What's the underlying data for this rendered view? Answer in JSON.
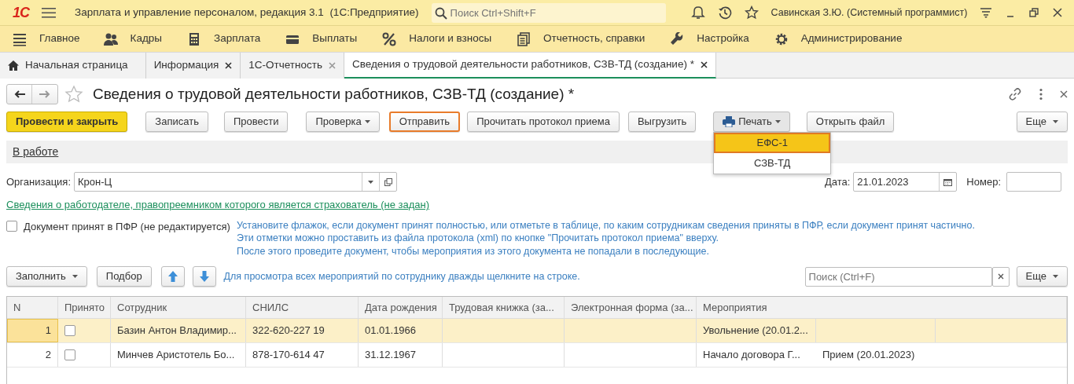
{
  "app_bar": {
    "logo": "1С",
    "title": "Зарплата и управление персоналом, редакция 3.1  (1С:Предприятие)",
    "search_placeholder": "Поиск Ctrl+Shift+F",
    "user": "Савинская З.Ю. (Системный программист)"
  },
  "sections": [
    {
      "label": "Главное"
    },
    {
      "label": "Кадры"
    },
    {
      "label": "Зарплата"
    },
    {
      "label": "Выплаты"
    },
    {
      "label": "Налоги и взносы"
    },
    {
      "label": "Отчетность, справки"
    },
    {
      "label": "Настройка"
    },
    {
      "label": "Администрирование"
    }
  ],
  "tabs": [
    {
      "label": "Начальная страница",
      "selected": false
    },
    {
      "label": "Информация",
      "selected": false
    },
    {
      "label": "1С-Отчетность",
      "selected": false
    },
    {
      "label": "Сведения о трудовой деятельности работников, СЗВ-ТД (создание) *",
      "selected": true
    }
  ],
  "document": {
    "title": "Сведения о трудовой деятельности работников, СЗВ-ТД (создание) *",
    "toolbar": [
      {
        "label": "Провести и закрыть",
        "kind": "primary"
      },
      {
        "label": "Записать",
        "kind": "plain"
      },
      {
        "label": "Провести",
        "kind": "plain"
      },
      {
        "label": "Проверка",
        "kind": "dropdown"
      },
      {
        "label": "Отправить",
        "kind": "focused"
      },
      {
        "label": "Прочитать протокол приема",
        "kind": "plain"
      },
      {
        "label": "Выгрузить",
        "kind": "plain"
      },
      {
        "label": "Печать",
        "kind": "print"
      },
      {
        "label": "Открыть файл",
        "kind": "plain"
      }
    ],
    "more": "Еще",
    "print_menu": [
      {
        "label": "ЕФС-1",
        "selected": true
      },
      {
        "label": "СЗВ-ТД",
        "selected": false
      }
    ],
    "status": "В работе",
    "organization": {
      "label": "Организация:",
      "value": "Крон-Ц"
    },
    "date": {
      "label": "Дата:",
      "value": "21.01.2023"
    },
    "number": {
      "label": "Номер:"
    },
    "employer_link": "Сведения о работодателе, правопреемником которого является страхователь (не задан)",
    "accepted": {
      "label": "Документ принят в ПФР (не редактируется)",
      "checked": false
    },
    "hints": [
      "Установите флажок, если документ принят полностью, или отметьте в таблице, по каким сотрудникам сведения приняты в ПФР, если документ принят частично.",
      "Эти отметки можно проставить из файла протокола (xml) по кнопке \"Прочитать протокол приема\" вверху.",
      "После этого проведите документ, чтобы мероприятия из этого документа не попадали в последующие."
    ]
  },
  "table_toolbar": {
    "fill": "Заполнить",
    "pick": "Подбор",
    "hint": "Для просмотра всех мероприятий по сотруднику дважды щелкните на строке.",
    "search_placeholder": "Поиск (Ctrl+F)",
    "more": "Еще"
  },
  "table": {
    "columns": [
      "N",
      "Принято",
      "Сотрудник",
      "СНИЛС",
      "Дата рождения",
      "Трудовая книжка (за...",
      "Электронная форма (за...",
      "Мероприятия"
    ],
    "rows": [
      {
        "n": "1",
        "accepted": false,
        "employee": "Базин Антон Владимир...",
        "snils": "322-620-227 19",
        "birth": "01.01.1966",
        "events": [
          "Увольнение (20.01.2..."
        ],
        "selected": true
      },
      {
        "n": "2",
        "accepted": false,
        "employee": "Минчев Аристотель Бо...",
        "snils": "878-170-614 47",
        "birth": "31.12.1967",
        "events": [
          "Начало договора Г...",
          "Прием (20.01.2023)"
        ],
        "selected": false
      }
    ]
  }
}
